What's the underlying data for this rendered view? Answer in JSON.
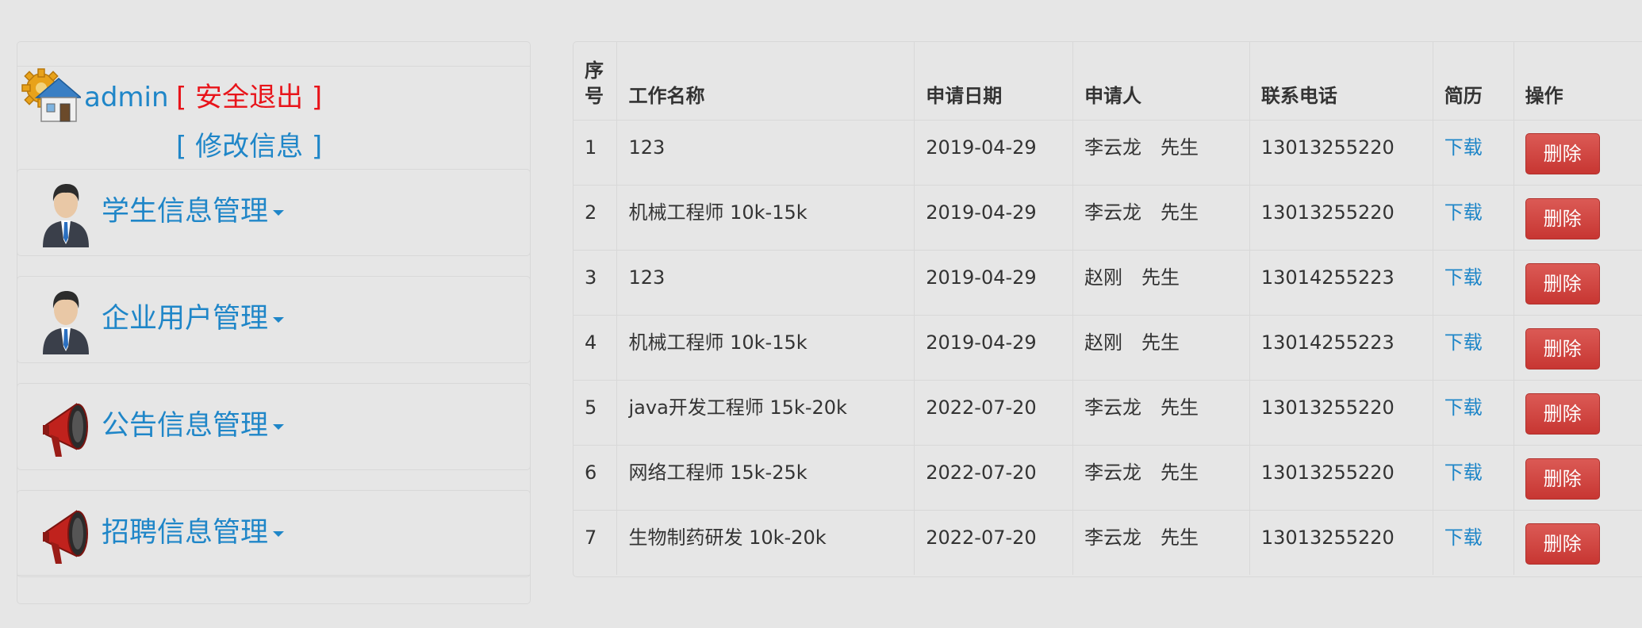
{
  "sidebar": {
    "admin_name": "admin",
    "logout_label": "[ 安全退出 ]",
    "edit_label": "[ 修改信息 ]",
    "menu": [
      {
        "label": "学生信息管理",
        "icon": "businessman-icon"
      },
      {
        "label": "企业用户管理",
        "icon": "businessman-icon"
      },
      {
        "label": "公告信息管理",
        "icon": "megaphone-icon"
      },
      {
        "label": "招聘信息管理",
        "icon": "megaphone-icon"
      }
    ]
  },
  "table": {
    "headers": {
      "seq": "序号",
      "job": "工作名称",
      "date": "申请日期",
      "applicant": "申请人",
      "phone": "联系电话",
      "resume": "简历",
      "action": "操作"
    },
    "download_label": "下载",
    "delete_label": "删除",
    "rows": [
      {
        "seq": "1",
        "job": "123",
        "date": "2019-04-29",
        "applicant": "李云龙　先生",
        "phone": "13013255220"
      },
      {
        "seq": "2",
        "job": "机械工程师 10k-15k",
        "date": "2019-04-29",
        "applicant": "李云龙　先生",
        "phone": "13013255220"
      },
      {
        "seq": "3",
        "job": "123",
        "date": "2019-04-29",
        "applicant": "赵刚　先生",
        "phone": "13014255223"
      },
      {
        "seq": "4",
        "job": "机械工程师 10k-15k",
        "date": "2019-04-29",
        "applicant": "赵刚　先生",
        "phone": "13014255223"
      },
      {
        "seq": "5",
        "job": "java开发工程师 15k-20k",
        "date": "2022-07-20",
        "applicant": "李云龙　先生",
        "phone": "13013255220"
      },
      {
        "seq": "6",
        "job": "网络工程师 15k-25k",
        "date": "2022-07-20",
        "applicant": "李云龙　先生",
        "phone": "13013255220"
      },
      {
        "seq": "7",
        "job": "生物制药研发 10k-20k",
        "date": "2022-07-20",
        "applicant": "李云龙　先生",
        "phone": "13013255220"
      }
    ]
  }
}
